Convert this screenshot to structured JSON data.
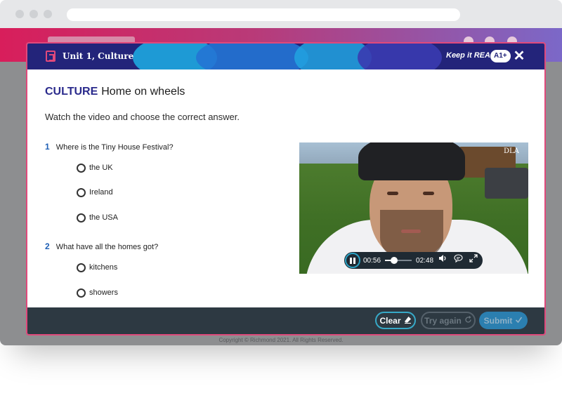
{
  "modal": {
    "unit_title": "Unit 1, Culture",
    "brand": "Keep it REAL!",
    "level": "A1+",
    "close_icon": "✕"
  },
  "activity": {
    "heading_tag": "CULTURE",
    "heading_title": "Home on wheels",
    "instruction": "Watch the video and choose the correct answer."
  },
  "questions": [
    {
      "number": "1",
      "text": "Where is the Tiny House Festival?",
      "options": [
        "the UK",
        "Ireland",
        "the USA"
      ]
    },
    {
      "number": "2",
      "text": "What have all the homes got?",
      "options": [
        "kitchens",
        "showers"
      ]
    }
  ],
  "video": {
    "watermark": "DLA",
    "current_time": "00:56",
    "duration": "02:48",
    "progress_fraction": 0.33,
    "icons": {
      "pause": "pause-icon",
      "volume": "volume-icon",
      "captions": "captions-icon",
      "fullscreen": "fullscreen-icon"
    }
  },
  "footer": {
    "clear_label": "Clear",
    "try_again_label": "Try again",
    "submit_label": "Submit"
  },
  "background_page": {
    "copyright": "Copyright © Richmond 2021. All Rights Reserved."
  },
  "colors": {
    "accent_pink": "#e0497b",
    "header_navy": "#23247a",
    "button_teal": "#37a9c7",
    "footer_bar": "#2d3942"
  }
}
